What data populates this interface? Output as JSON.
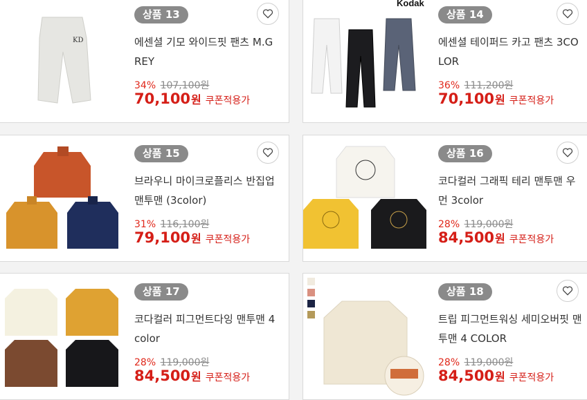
{
  "products": [
    {
      "badge": "상품 13",
      "title": "에센셜 기모 와이드핏 팬츠 M.GREY",
      "discount": "34%",
      "original": "107,100원",
      "price": "70,100",
      "won": "원",
      "coupon": "쿠폰적용가"
    },
    {
      "badge": "상품 14",
      "title": "에센셜 테이퍼드 카고 팬츠 3COLOR",
      "discount": "36%",
      "original": "111,200원",
      "price": "70,100",
      "won": "원",
      "coupon": "쿠폰적용가",
      "brand": "Kodak"
    },
    {
      "badge": "상품 15",
      "title": "브라우니 마이크로플리스 반집업 맨투맨 (3color)",
      "discount": "31%",
      "original": "116,100원",
      "price": "79,100",
      "won": "원",
      "coupon": "쿠폰적용가"
    },
    {
      "badge": "상품 16",
      "title": "코다컬러 그래픽 테리 맨투맨 우먼 3color",
      "discount": "28%",
      "original": "119,000원",
      "price": "84,500",
      "won": "원",
      "coupon": "쿠폰적용가"
    },
    {
      "badge": "상품 17",
      "title": "코다컬러 피그먼트다잉 맨투맨 4color",
      "discount": "28%",
      "original": "119,000원",
      "price": "84,500",
      "won": "원",
      "coupon": "쿠폰적용가"
    },
    {
      "badge": "상품 18",
      "title": "트립 피그먼트워싱 세미오버핏 맨투맨 4 COLOR",
      "discount": "28%",
      "original": "119,000원",
      "price": "84,500",
      "won": "원",
      "coupon": "쿠폰적용가"
    }
  ],
  "icons": {
    "wishlist": "heart-icon"
  },
  "colors": {
    "price": "#d51e17",
    "badge_bg": "#8a8a8a",
    "discount": "#e0271a"
  }
}
